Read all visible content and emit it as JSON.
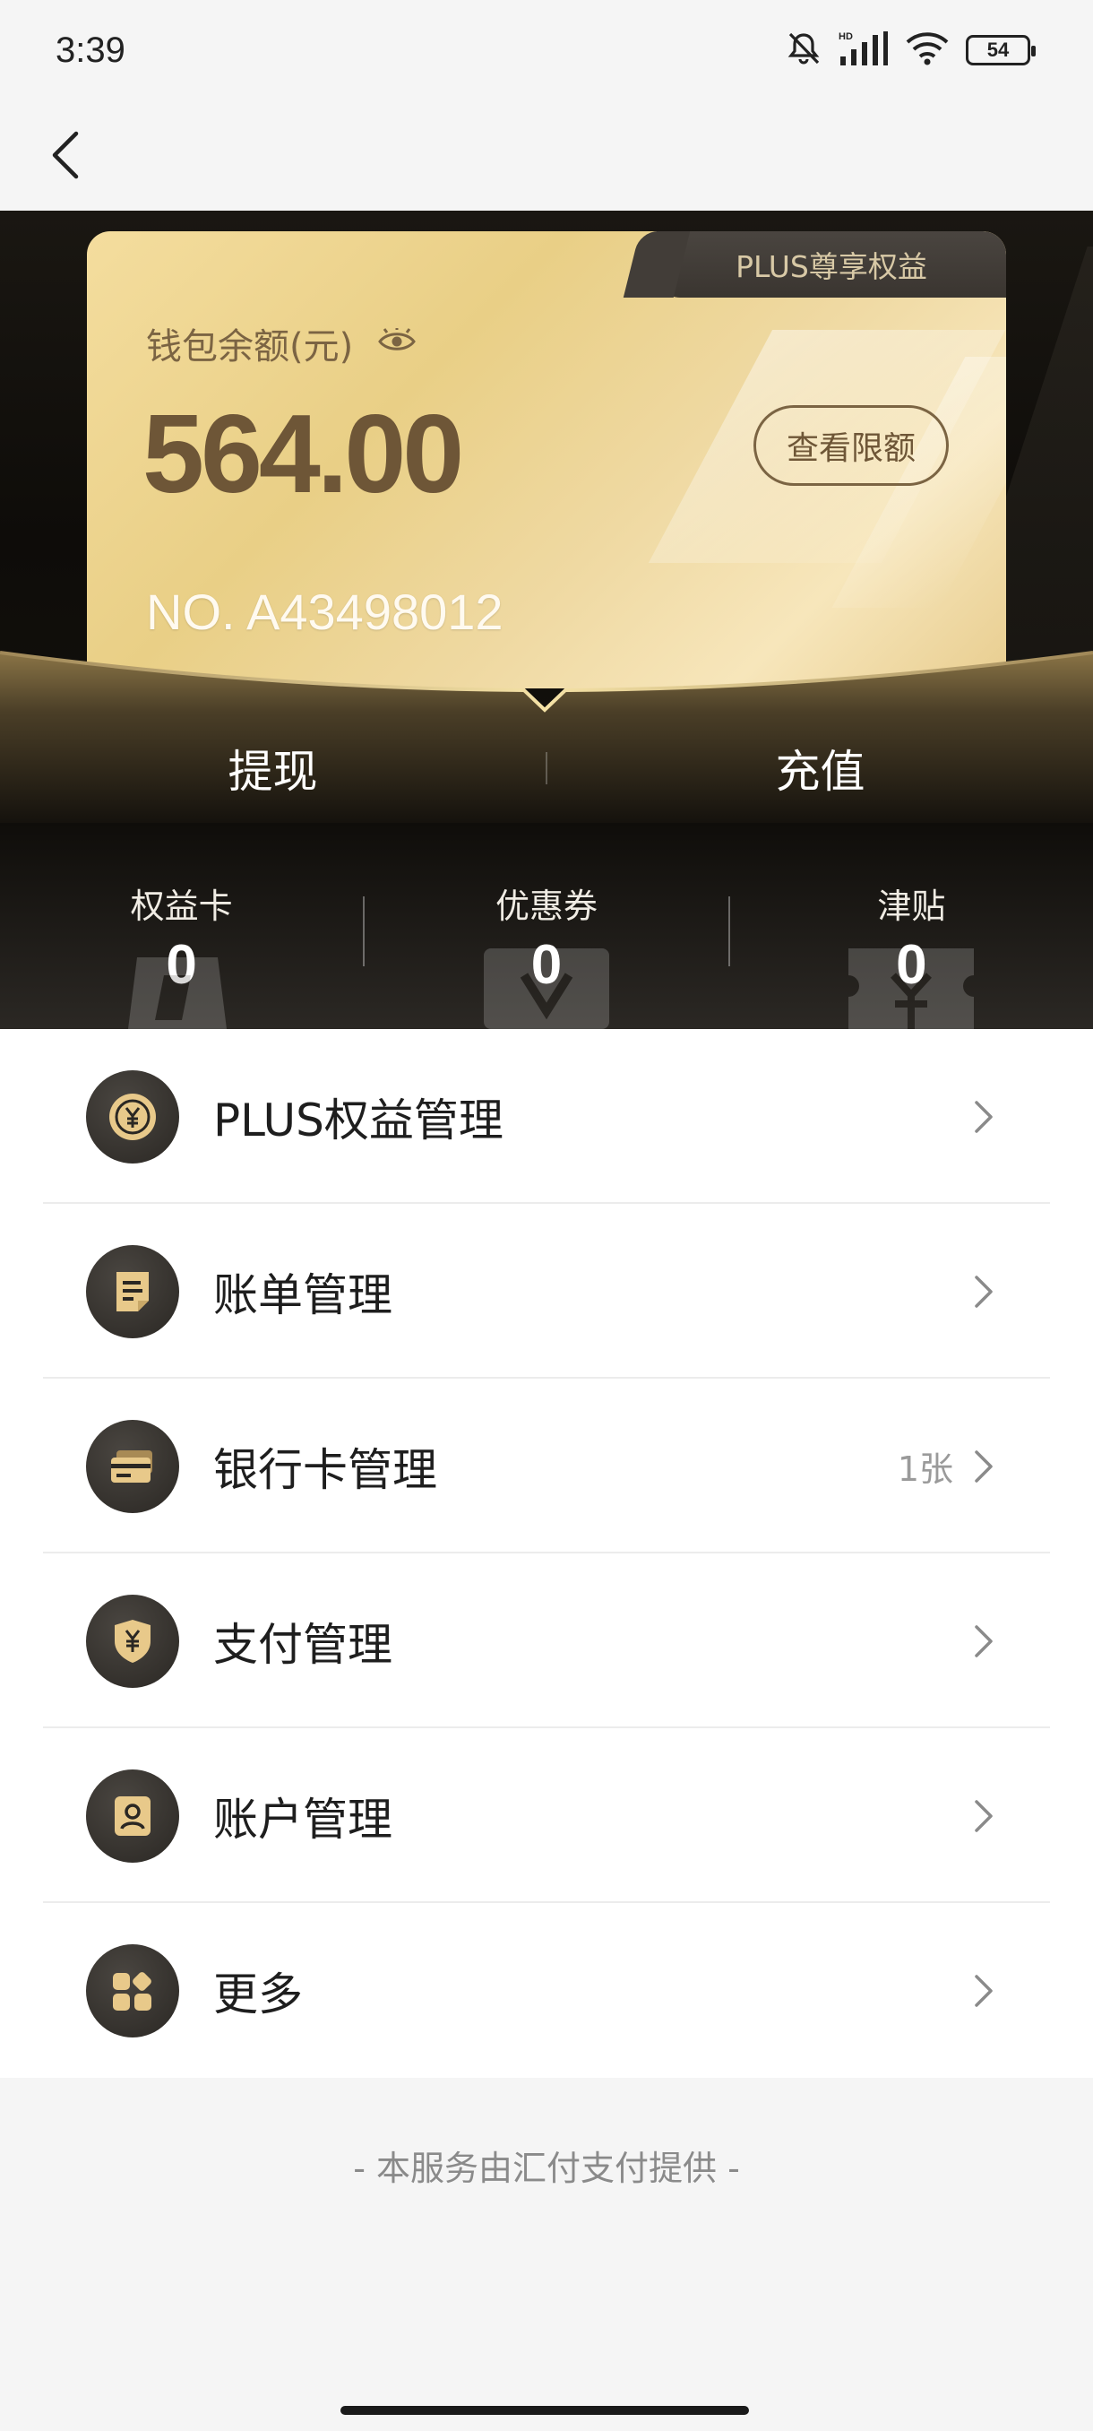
{
  "status_bar": {
    "time": "3:39",
    "battery": "54",
    "network": "HD"
  },
  "wallet": {
    "badge": "PLUS尊享权益",
    "balance_label": "钱包余额(元)",
    "balance": "564.00",
    "limit_button": "查看限额",
    "card_no": "NO. A43498012"
  },
  "actions": {
    "withdraw": "提现",
    "recharge": "充值"
  },
  "stats": [
    {
      "label": "权益卡",
      "value": "0"
    },
    {
      "label": "优惠券",
      "value": "0"
    },
    {
      "label": "津贴",
      "value": "0"
    }
  ],
  "menu": [
    {
      "label": "PLUS权益管理",
      "icon": "plus-coin-icon",
      "extra": ""
    },
    {
      "label": "账单管理",
      "icon": "bill-icon",
      "extra": ""
    },
    {
      "label": "银行卡管理",
      "icon": "bank-card-icon",
      "extra": "1张"
    },
    {
      "label": "支付管理",
      "icon": "payment-shield-icon",
      "extra": ""
    },
    {
      "label": "账户管理",
      "icon": "account-icon",
      "extra": ""
    },
    {
      "label": "更多",
      "icon": "more-grid-icon",
      "extra": ""
    }
  ],
  "footer": "- 本服务由汇付支付提供 -",
  "colors": {
    "gold": "#e9cf86",
    "dark": "#1a1712",
    "icon_gold": "#e8c98a"
  }
}
